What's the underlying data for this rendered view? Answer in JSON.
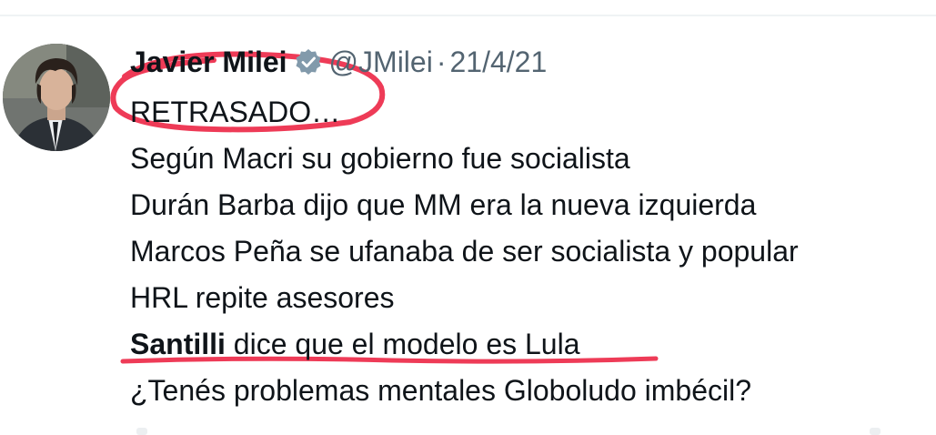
{
  "tweet": {
    "author_name": "Javier Milei",
    "handle": "@JMilei",
    "separator": "·",
    "date": "21/4/21",
    "verified_icon": "verified-badge-icon",
    "lines": {
      "l1": "RETRASADO…",
      "l2": "Según Macri su gobierno fue socialista",
      "l3": "Durán Barba dijo que MM era la nueva izquierda",
      "l4": "Marcos Peña se ufanaba de ser socialista y popular",
      "l5": "HRL repite asesores",
      "l6_bold": "Santilli",
      "l6_rest": " dice que el modelo es Lula",
      "l7": "¿Tenés problemas mentales Globoludo imbécil?"
    }
  },
  "colors": {
    "text": "#0f1419",
    "muted": "#536471",
    "annotation": "#ee3b57",
    "divider": "#eff3f4"
  }
}
